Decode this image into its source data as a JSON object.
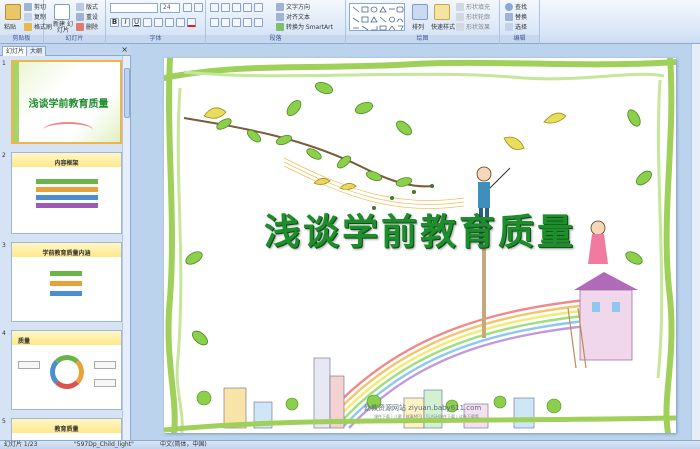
{
  "ribbon": {
    "clipboard": {
      "paste": "粘贴",
      "cut": "剪切",
      "copy": "复制",
      "format_painter": "格式刷",
      "label": "剪贴板"
    },
    "slides": {
      "new_slide": "新建\n幻灯片",
      "layout": "版式",
      "reset": "重设",
      "delete": "删除",
      "label": "幻灯片"
    },
    "font": {
      "font_name": "",
      "font_size": "24",
      "label": "字体"
    },
    "paragraph": {
      "text_direction": "文字方向",
      "align_text": "对齐文本",
      "convert_smartart": "转换为 SmartArt",
      "label": "段落"
    },
    "drawing": {
      "arrange": "排列",
      "quick_styles": "快速样式",
      "shape_fill": "形状填充",
      "shape_outline": "形状轮廓",
      "shape_effects": "形状效果",
      "label": "绘图"
    },
    "editing": {
      "find": "查找",
      "replace": "替换",
      "select": "选择",
      "label": "编辑"
    }
  },
  "pane": {
    "tab_slides": "幻灯片",
    "tab_outline": "大纲",
    "thumbs": [
      {
        "num": "1",
        "title": "浅谈学前教育质量"
      },
      {
        "num": "2",
        "title": "内容框架"
      },
      {
        "num": "3",
        "title": "学前教育质量内涵"
      },
      {
        "num": "4",
        "title": "质量"
      },
      {
        "num": "5",
        "title": "教育质量"
      }
    ]
  },
  "slide": {
    "title": "浅谈学前教育质量",
    "watermark": "幼教资源网站 ziyuan.baby611.com",
    "watermark_sub": "课件下载 | 儿歌 | 故事MP3 | FLASH课件下载 | 试卷下载等"
  },
  "status": {
    "slide_pos": "幻灯片 1/23",
    "theme": "\"597Dp_Child_light\"",
    "language": "中文(简体，中国)"
  },
  "colors": {
    "title_green": "#1e8e2c",
    "ribbon_bg": "#dbe7f7",
    "workspace": "#bcd3ee",
    "selected_thumb": "#f0b54a"
  }
}
